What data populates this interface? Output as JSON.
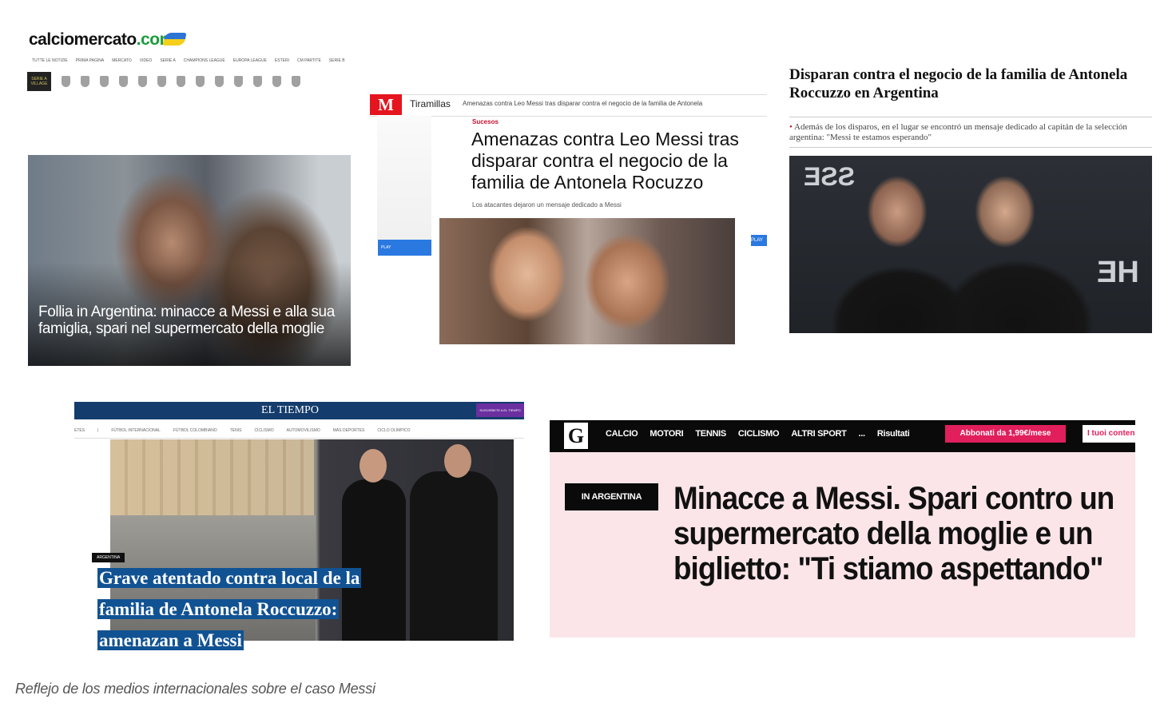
{
  "calciomercato": {
    "logo_main": "calciomercato",
    "logo_dot": ".com",
    "nav": [
      "TUTTE LE NOTIZIE",
      "PRIMA PAGINA",
      "MERCATO",
      "VIDEO",
      "SERIE A",
      "CHAMPIONS LEAGUE",
      "EUROPA LEAGUE",
      "ESTERI",
      "CM PARTITE",
      "SERIE B"
    ],
    "crest_tag": "SERIE A VILLAGE",
    "headline": "Follia in Argentina: minacce a Messi e alla sua famiglia, spari nel supermercato della moglie"
  },
  "marca": {
    "logo": "M",
    "section": "Tiramillas",
    "crumb": "Amenazas contra Leo Messi tras disparar contra el negocio de la familia de Antonela",
    "kicker": "Sucesos",
    "headline": "Amenazas contra Leo Messi tras disparar contra el negocio de la familia de Antonela Rocuzzo",
    "subheadline": "Los atacantes dejaron un mensaje dedicado a Messi",
    "left_button": "PLAY",
    "right_button": "PLAY"
  },
  "abc": {
    "headline": "Disparan contra el negocio de la familia de Antonela Roccuzzo en Argentina",
    "summary": "Además de los disparos, en el lugar se encontró un mensaje dedicado al capitán de la selección argentina: \"Messi te estamos esperando\""
  },
  "eltiempo": {
    "logo": "EL TIEMPO",
    "subscribe": "SUSCRÍBETE A EL TIEMPO",
    "nav": [
      "ETES",
      "|",
      "FÚTBOL INTERNACIONAL",
      "FÚTBOL COLOMBIANO",
      "TENIS",
      "CICLISMO",
      "AUTOMOVILISMO",
      "MÁS DEPORTES",
      "CICLO OLÍMPICO"
    ],
    "kicker": "ARGENTINA",
    "headline": "Grave atentado contra local de la familia de Antonela Roccuzzo: amenazan a Messi"
  },
  "gazzetta": {
    "logo": "G",
    "nav": [
      "CALCIO",
      "MOTORI",
      "TENNIS",
      "CICLISMO",
      "ALTRI SPORT",
      "...",
      "Risultati"
    ],
    "subscribe": "Abbonati da 1,99€/mese",
    "user": "I tuoi contenuti",
    "tag": "IN ARGENTINA",
    "headline": "Minacce a Messi. Spari contro un supermercato della moglie e un biglietto: \"Ti stiamo aspettando\""
  },
  "caption": "Reflejo de los medios internacionales sobre el caso Messi",
  "colors": {
    "marca_red": "#e4151f",
    "eltiempo_blue": "#143c6c",
    "eltiempo_highlight": "#115293",
    "gazzetta_pink": "#e01f5c",
    "gazzetta_panel": "#fbe5e8",
    "calciomercato_green": "#1a9c3c"
  }
}
